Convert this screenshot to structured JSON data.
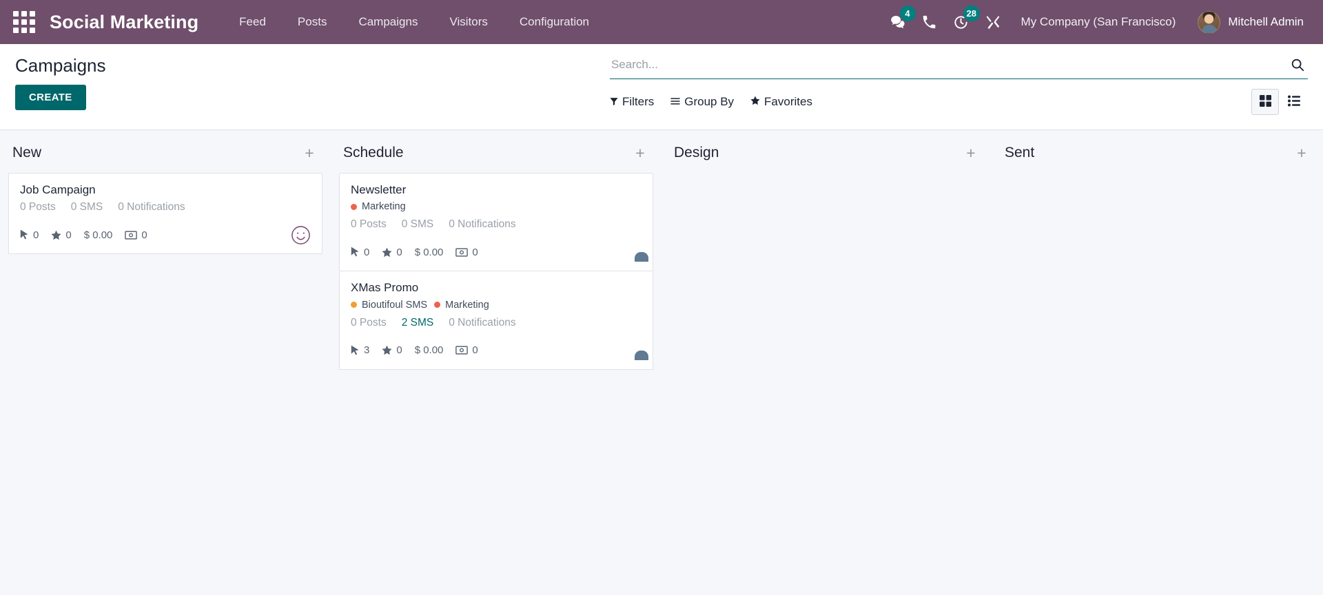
{
  "navbar": {
    "apps_icon": "apps-grid-icon",
    "brand": "Social Marketing",
    "menu": [
      {
        "label": "Feed",
        "name": "nav-item-feed"
      },
      {
        "label": "Posts",
        "name": "nav-item-posts"
      },
      {
        "label": "Campaigns",
        "name": "nav-item-campaigns"
      },
      {
        "label": "Visitors",
        "name": "nav-item-visitors"
      },
      {
        "label": "Configuration",
        "name": "nav-item-configuration"
      }
    ],
    "messages": {
      "icon": "messages-icon",
      "badge": "4"
    },
    "phone": {
      "icon": "phone-icon"
    },
    "activities": {
      "icon": "activity-clock-icon",
      "badge": "28"
    },
    "tools": {
      "icon": "wrench-tools-icon"
    },
    "company": "My Company (San Francisco)",
    "user": "Mitchell Admin",
    "avatar_icon": "user-avatar",
    "bg_color": "#6f4f6b",
    "badge_color": "#00807f"
  },
  "control_panel": {
    "title": "Campaigns",
    "create_label": "CREATE",
    "create_color": "#00676a",
    "search": {
      "placeholder": "Search...",
      "value": "",
      "icon": "search-icon"
    },
    "filters": [
      {
        "label": "Filters",
        "icon": "filter-funnel-icon",
        "name": "filters-button"
      },
      {
        "label": "Group By",
        "icon": "group-by-lines-icon",
        "name": "group-by-button"
      },
      {
        "label": "Favorites",
        "icon": "star-icon",
        "name": "favorites-button"
      }
    ],
    "views": [
      {
        "name": "kanban-view-button",
        "icon": "kanban-grid-icon",
        "active": true
      },
      {
        "name": "list-view-button",
        "icon": "list-icon",
        "active": false
      }
    ]
  },
  "kanban": {
    "add_glyph": "+",
    "columns": [
      {
        "title": "New",
        "cards": [
          {
            "title": "Job Campaign",
            "tags": [],
            "stats": [
              {
                "label": "0 Posts",
                "link": false
              },
              {
                "label": "0 SMS",
                "link": false
              },
              {
                "label": "0 Notifications",
                "link": false
              }
            ],
            "metrics": {
              "clicks": "0",
              "leads": "0",
              "revenue": "$ 0.00",
              "invoiced": "0"
            },
            "avatar": "smiley"
          }
        ]
      },
      {
        "title": "Schedule",
        "cards": [
          {
            "title": "Newsletter",
            "tags": [
              {
                "label": "Marketing",
                "color": "#f06050"
              }
            ],
            "stats": [
              {
                "label": "0 Posts",
                "link": false
              },
              {
                "label": "0 SMS",
                "link": false
              },
              {
                "label": "0 Notifications",
                "link": false
              }
            ],
            "metrics": {
              "clicks": "0",
              "leads": "0",
              "revenue": "$ 0.00",
              "invoiced": "0"
            },
            "avatar": "photo"
          },
          {
            "title": "XMas Promo",
            "tags": [
              {
                "label": "Bioutifoul SMS",
                "color": "#f0a030"
              },
              {
                "label": "Marketing",
                "color": "#f06050"
              }
            ],
            "stats": [
              {
                "label": "0 Posts",
                "link": false
              },
              {
                "label": "2 SMS",
                "link": true
              },
              {
                "label": "0 Notifications",
                "link": false
              }
            ],
            "metrics": {
              "clicks": "3",
              "leads": "0",
              "revenue": "$ 0.00",
              "invoiced": "0"
            },
            "avatar": "photo"
          }
        ]
      },
      {
        "title": "Design",
        "cards": []
      },
      {
        "title": "Sent",
        "cards": []
      }
    ]
  }
}
